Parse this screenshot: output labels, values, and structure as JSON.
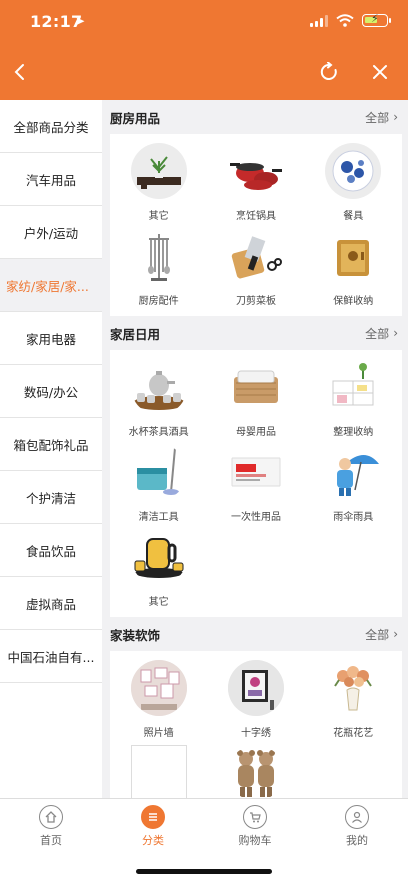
{
  "status": {
    "time": "12:17"
  },
  "sidebar": {
    "items": [
      {
        "label": "全部商品分类"
      },
      {
        "label": "汽车用品"
      },
      {
        "label": "户外/运动"
      },
      {
        "label": "家纺/家居/家..."
      },
      {
        "label": "家用电器"
      },
      {
        "label": "数码/办公"
      },
      {
        "label": "箱包配饰礼品"
      },
      {
        "label": "个护清洁"
      },
      {
        "label": "食品饮品"
      },
      {
        "label": "虚拟商品"
      },
      {
        "label": "中国石油自有..."
      }
    ],
    "active_index": 3
  },
  "sections": [
    {
      "title": "厨房用品",
      "all_label": "全部",
      "items": [
        {
          "label": "其它",
          "icon": "shelf-plant-icon"
        },
        {
          "label": "烹饪锅具",
          "icon": "cookware-icon"
        },
        {
          "label": "餐具",
          "icon": "dinnerware-icon"
        },
        {
          "label": "厨房配件",
          "icon": "utensil-rack-icon"
        },
        {
          "label": "刀剪菜板",
          "icon": "knife-board-icon"
        },
        {
          "label": "保鲜收纳",
          "icon": "storage-box-icon"
        }
      ]
    },
    {
      "title": "家居日用",
      "all_label": "全部",
      "items": [
        {
          "label": "水杯茶具酒具",
          "icon": "tea-set-icon"
        },
        {
          "label": "母婴用品",
          "icon": "baby-basket-icon"
        },
        {
          "label": "整理收纳",
          "icon": "shelf-icon"
        },
        {
          "label": "清洁工具",
          "icon": "mop-bucket-icon"
        },
        {
          "label": "一次性用品",
          "icon": "disposable-pack-icon"
        },
        {
          "label": "雨伞雨具",
          "icon": "umbrella-icon"
        },
        {
          "label": "其它",
          "icon": "kettle-icon"
        }
      ]
    },
    {
      "title": "家装软饰",
      "all_label": "全部",
      "items": [
        {
          "label": "照片墙",
          "icon": "photo-wall-icon"
        },
        {
          "label": "十字绣",
          "icon": "cross-stitch-icon"
        },
        {
          "label": "花瓶花艺",
          "icon": "flower-vase-icon"
        },
        {
          "label": "",
          "icon": "blank-image-icon"
        },
        {
          "label": "",
          "icon": "teddy-bears-icon"
        }
      ]
    }
  ],
  "tabbar": {
    "items": [
      {
        "label": "首页",
        "icon": "home-icon"
      },
      {
        "label": "分类",
        "icon": "category-icon"
      },
      {
        "label": "购物车",
        "icon": "cart-icon"
      },
      {
        "label": "我的",
        "icon": "user-icon"
      }
    ],
    "active_index": 1
  },
  "colors": {
    "accent": "#ef7732"
  }
}
